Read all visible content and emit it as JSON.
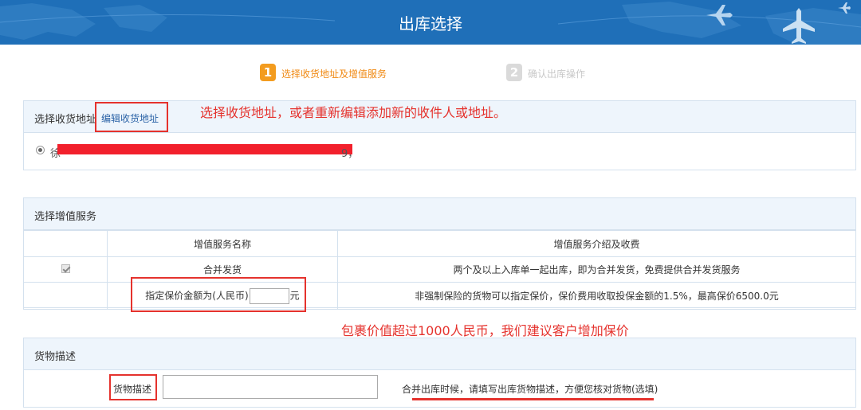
{
  "header": {
    "title": "出库选择"
  },
  "steps": [
    {
      "num": "1",
      "label": "选择收货地址及增值服务",
      "active": true
    },
    {
      "num": "2",
      "label": "确认出库操作",
      "active": false
    }
  ],
  "address_panel": {
    "title": "选择收货地址",
    "edit_link": "编辑收货地址",
    "annotation": "选择收货地址，或者重新编辑添加新的收件人或地址。",
    "address_start": "徐",
    "address_end": "9，"
  },
  "vas_panel": {
    "title": "选择增值服务",
    "headers": [
      "",
      "增值服务名称",
      "增值服务介绍及收费"
    ],
    "rows": [
      {
        "checked": true,
        "name": "合并发货",
        "desc": "两个及以上入库单一起出库，即为合并发货，免费提供合并发货服务"
      },
      {
        "name_prefix": "指定保价金额为(人民币)",
        "name_suffix": "元",
        "insure_value": "",
        "desc": "非强制保险的货物可以指定保价，保价费用收取投保金额的1.5%，最高保价6500.0元"
      }
    ],
    "annotation": "包裹价值超过1000人民币，我们建议客户增加保价"
  },
  "desc_panel": {
    "title": "货物描述",
    "label": "货物描述",
    "input_value": "",
    "hint": "合并出库时候，请填写出库货物描述，方便您核对货物(选填)"
  },
  "colors": {
    "header_bg": "#1f6fb8",
    "step_active": "#f39c1f",
    "annotation_red": "#e5322d",
    "link": "#2a62a6"
  }
}
